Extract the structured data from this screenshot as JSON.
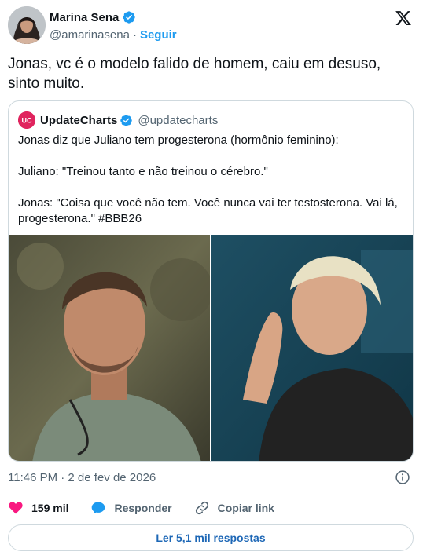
{
  "author": {
    "display_name": "Marina Sena",
    "handle": "@amarinasena",
    "separator": "·",
    "follow_label": "Seguir"
  },
  "tweet": {
    "text": "Jonas, vc é o modelo falido de homem, caiu em desuso, sinto muito."
  },
  "quote": {
    "avatar_text": "UC",
    "display_name": "UpdateCharts",
    "handle": "@updatecharts",
    "paragraphs": [
      "Jonas diz que Juliano tem progesterona (hormônio feminino):",
      "Juliano: \"Treinou tanto e não treinou o cérebro.\"",
      "Jonas: \"Coisa que você não tem. Você nunca vai ter testosterona. Vai lá, progesterona.\" #BBB26"
    ]
  },
  "meta": {
    "timestamp": "11:46 PM · 2 de fev de 2026"
  },
  "actions": {
    "likes": "159 mil",
    "reply_label": "Responder",
    "copy_link_label": "Copiar link"
  },
  "replies_button": "Ler 5,1 mil respostas",
  "colors": {
    "accent": "#1d9bf0",
    "like": "#f91880",
    "text": "#0f1419",
    "muted": "#536471",
    "border": "#cfd9de",
    "brand_pink": "#e0245e"
  },
  "icons": [
    "verified-badge-icon",
    "x-logo-icon",
    "info-icon",
    "heart-icon",
    "reply-bubble-icon",
    "link-icon"
  ]
}
